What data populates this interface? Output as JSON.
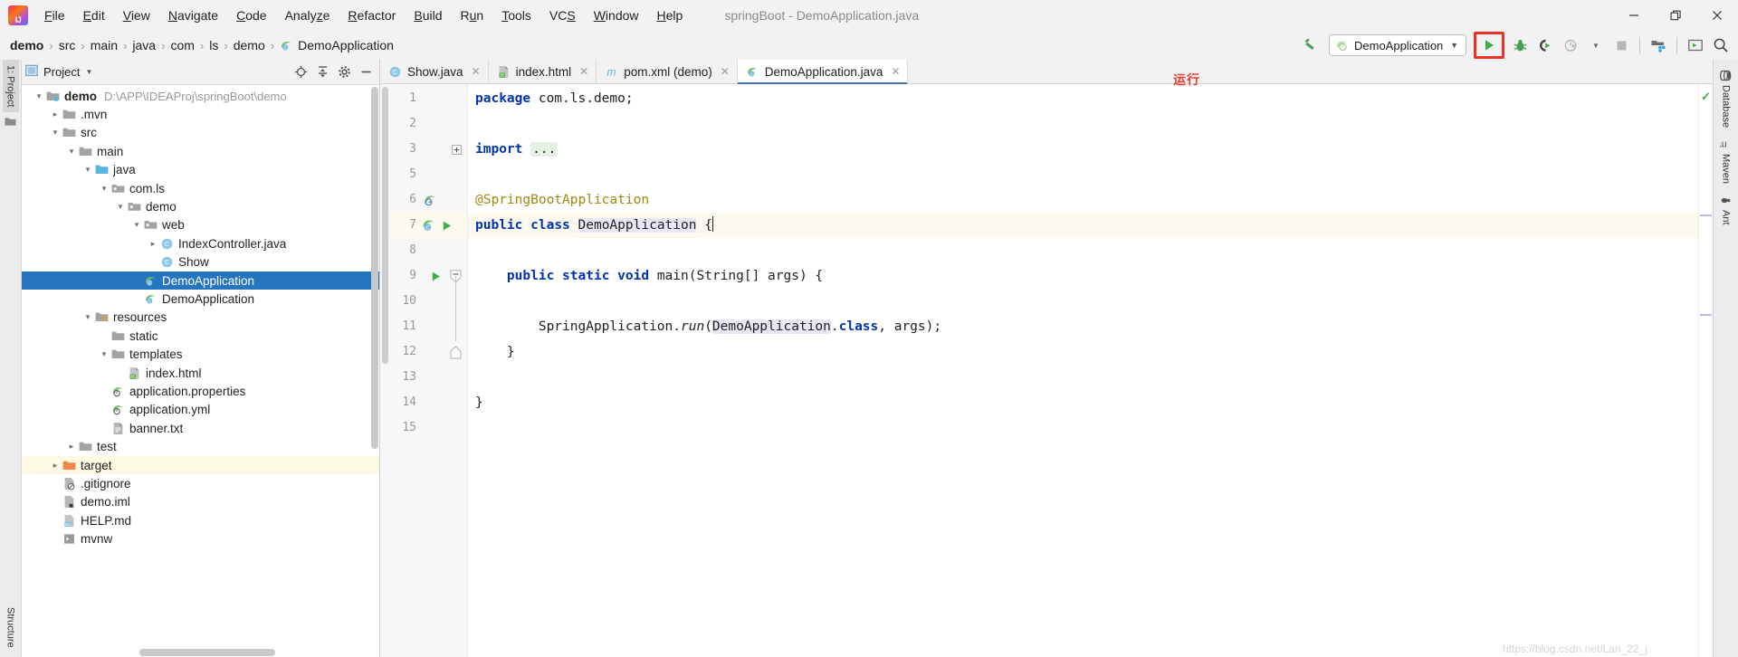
{
  "window": {
    "title": "springBoot - DemoApplication.java",
    "minimize": "—",
    "maximize": "❐",
    "close": "✕"
  },
  "menu": {
    "items": [
      {
        "label": "File"
      },
      {
        "label": "Edit"
      },
      {
        "label": "View"
      },
      {
        "label": "Navigate"
      },
      {
        "label": "Code"
      },
      {
        "label": "Analyze"
      },
      {
        "label": "Refactor"
      },
      {
        "label": "Build"
      },
      {
        "label": "Run"
      },
      {
        "label": "Tools"
      },
      {
        "label": "VCS"
      },
      {
        "label": "Window"
      },
      {
        "label": "Help"
      }
    ]
  },
  "breadcrumb": {
    "separator": "›",
    "items": [
      {
        "label": "demo",
        "bold": true
      },
      {
        "label": "src"
      },
      {
        "label": "main"
      },
      {
        "label": "java"
      },
      {
        "label": "com"
      },
      {
        "label": "ls"
      },
      {
        "label": "demo"
      },
      {
        "label": "DemoApplication",
        "icon": "spring-class-icon"
      }
    ]
  },
  "toolbar": {
    "build_label": "build-hammer-icon",
    "run_config": "DemoApplication",
    "run_config_arrow": "▼",
    "buttons": [
      {
        "name": "run-button",
        "icon": "play-icon"
      },
      {
        "name": "debug-button",
        "icon": "bug-icon"
      },
      {
        "name": "run-with-coverage-button",
        "icon": "coverage-icon"
      },
      {
        "name": "profile-button",
        "icon": "profiler-icon"
      },
      {
        "name": "stop-button",
        "icon": "stop-icon"
      },
      {
        "name": "open-project-structure-button",
        "icon": "project-structure-icon"
      },
      {
        "name": "terminal-button",
        "icon": "terminal-icon"
      },
      {
        "name": "search-everywhere-button",
        "icon": "search-icon"
      }
    ],
    "annotation": "运行"
  },
  "left_strip": {
    "tabs": [
      {
        "label": "1: Project",
        "active": true
      },
      {
        "label": "Structure",
        "active": false
      }
    ]
  },
  "project_panel": {
    "title": "Project",
    "title_arrow": "▼",
    "actions": [
      {
        "name": "scroll-from-source-button",
        "icon": "target-icon"
      },
      {
        "name": "collapse-all-button",
        "icon": "collapse-icon"
      },
      {
        "name": "settings-button",
        "icon": "gear-icon"
      },
      {
        "name": "hide-button",
        "icon": "minus-icon"
      }
    ],
    "tree": [
      {
        "depth": 0,
        "twisty": "⌄",
        "icon": "module-folder-icon",
        "label": "demo",
        "bold": true,
        "path": "D:\\APP\\IDEAProj\\springBoot\\demo"
      },
      {
        "depth": 1,
        "twisty": "›",
        "icon": "folder-icon",
        "label": ".mvn"
      },
      {
        "depth": 1,
        "twisty": "⌄",
        "icon": "folder-icon",
        "label": "src"
      },
      {
        "depth": 2,
        "twisty": "⌄",
        "icon": "folder-icon",
        "label": "main"
      },
      {
        "depth": 3,
        "twisty": "⌄",
        "icon": "source-folder-icon",
        "label": "java"
      },
      {
        "depth": 4,
        "twisty": "⌄",
        "icon": "package-icon",
        "label": "com.ls"
      },
      {
        "depth": 5,
        "twisty": "⌄",
        "icon": "package-icon",
        "label": "demo"
      },
      {
        "depth": 6,
        "twisty": "⌄",
        "icon": "package-icon",
        "label": "web"
      },
      {
        "depth": 7,
        "twisty": "›",
        "icon": "java-class-icon",
        "label": "IndexController.java"
      },
      {
        "depth": 7,
        "twisty": "",
        "icon": "java-class-icon",
        "label": "Show"
      },
      {
        "depth": 6,
        "twisty": "",
        "icon": "spring-class-icon",
        "label": "DemoApplication",
        "selected": true
      },
      {
        "depth": 6,
        "twisty": "",
        "icon": "spring-class-icon",
        "label": "DemoApplication"
      },
      {
        "depth": 3,
        "twisty": "⌄",
        "icon": "resources-folder-icon",
        "label": "resources"
      },
      {
        "depth": 4,
        "twisty": "",
        "icon": "folder-icon",
        "label": "static"
      },
      {
        "depth": 4,
        "twisty": "⌄",
        "icon": "folder-icon",
        "label": "templates"
      },
      {
        "depth": 5,
        "twisty": "",
        "icon": "html-file-icon",
        "label": "index.html"
      },
      {
        "depth": 4,
        "twisty": "",
        "icon": "spring-config-icon",
        "label": "application.properties"
      },
      {
        "depth": 4,
        "twisty": "",
        "icon": "spring-config-icon",
        "label": "application.yml"
      },
      {
        "depth": 4,
        "twisty": "",
        "icon": "text-file-icon",
        "label": "banner.txt"
      },
      {
        "depth": 2,
        "twisty": "›",
        "icon": "folder-icon",
        "label": "test"
      },
      {
        "depth": 1,
        "twisty": "›",
        "icon": "excluded-folder-icon",
        "label": "target",
        "excluded": true
      },
      {
        "depth": 1,
        "twisty": "",
        "icon": "gitignore-file-icon",
        "label": ".gitignore"
      },
      {
        "depth": 1,
        "twisty": "",
        "icon": "iml-file-icon",
        "label": "demo.iml"
      },
      {
        "depth": 1,
        "twisty": "",
        "icon": "markdown-file-icon",
        "label": "HELP.md"
      },
      {
        "depth": 1,
        "twisty": "",
        "icon": "script-file-icon",
        "label": "mvnw"
      }
    ]
  },
  "editor": {
    "tabs": [
      {
        "label": "Show.java",
        "icon": "java-class-icon",
        "close": "✕",
        "active": false
      },
      {
        "label": "index.html",
        "icon": "html-file-icon",
        "close": "✕",
        "active": false
      },
      {
        "label": "pom.xml (demo)",
        "icon": "maven-file-icon",
        "close": "✕",
        "active": false
      },
      {
        "label": "DemoApplication.java",
        "icon": "spring-class-icon",
        "close": "✕",
        "active": true
      }
    ],
    "line_numbers": [
      "1",
      "2",
      "3",
      "5",
      "6",
      "7",
      "8",
      "9",
      "10",
      "11",
      "12",
      "13",
      "14",
      "15"
    ],
    "code_lines": [
      {
        "n": "1",
        "segments": [
          {
            "t": "package",
            "c": "k"
          },
          {
            "t": " com.ls.demo;",
            "c": "st"
          }
        ]
      },
      {
        "n": "2",
        "segments": []
      },
      {
        "n": "3",
        "segments": [
          {
            "t": "import",
            "c": "k"
          },
          {
            "t": " ",
            "c": "st"
          },
          {
            "t": "...",
            "c": "fold"
          }
        ]
      },
      {
        "n": "5",
        "segments": []
      },
      {
        "n": "6",
        "segments": [
          {
            "t": "@SpringBootApplication",
            "c": "an"
          }
        ]
      },
      {
        "n": "7",
        "segments": [
          {
            "t": "public",
            "c": "k"
          },
          {
            "t": " ",
            "c": "st"
          },
          {
            "t": "class",
            "c": "k"
          },
          {
            "t": " ",
            "c": "st"
          },
          {
            "t": "DemoApplication",
            "c": "idhl"
          },
          {
            "t": " {",
            "c": "st"
          }
        ],
        "caret": true
      },
      {
        "n": "8",
        "segments": []
      },
      {
        "n": "9",
        "segments": [
          {
            "t": "    ",
            "c": "st"
          },
          {
            "t": "public",
            "c": "k"
          },
          {
            "t": " ",
            "c": "st"
          },
          {
            "t": "static",
            "c": "k"
          },
          {
            "t": " ",
            "c": "st"
          },
          {
            "t": "void",
            "c": "k"
          },
          {
            "t": " ",
            "c": "st"
          },
          {
            "t": "main",
            "c": "id"
          },
          {
            "t": "(String[] args) {",
            "c": "st"
          }
        ]
      },
      {
        "n": "10",
        "segments": []
      },
      {
        "n": "11",
        "segments": [
          {
            "t": "        SpringApplication.",
            "c": "st"
          },
          {
            "t": "run",
            "c": "it"
          },
          {
            "t": "(",
            "c": "st"
          },
          {
            "t": "DemoApplication",
            "c": "idhl"
          },
          {
            "t": ".",
            "c": "st"
          },
          {
            "t": "class",
            "c": "k"
          },
          {
            "t": ", args);",
            "c": "st"
          }
        ]
      },
      {
        "n": "12",
        "segments": [
          {
            "t": "    }",
            "c": "st"
          }
        ]
      },
      {
        "n": "13",
        "segments": []
      },
      {
        "n": "14",
        "segments": [
          {
            "t": "}",
            "c": "st"
          }
        ]
      },
      {
        "n": "15",
        "segments": []
      }
    ],
    "status_ok": "✓",
    "watermark": "https://blog.csdn.net/Lan_22_j"
  },
  "right_strip": {
    "tabs": [
      {
        "label": "Database",
        "icon": "database-icon"
      },
      {
        "label": "Maven",
        "icon": "maven-icon"
      },
      {
        "label": "Ant",
        "icon": "ant-icon"
      }
    ]
  },
  "colors": {
    "selection_blue": "#2675bf",
    "caret_line": "#fcfaef",
    "excluded_yellow": "#fdfae3",
    "keyword_blue": "#0033b3",
    "annotation_gold": "#9e880d",
    "run_green": "#3fae49",
    "annotation_red": "#e8412f",
    "highlight_red": "#ee3124"
  }
}
